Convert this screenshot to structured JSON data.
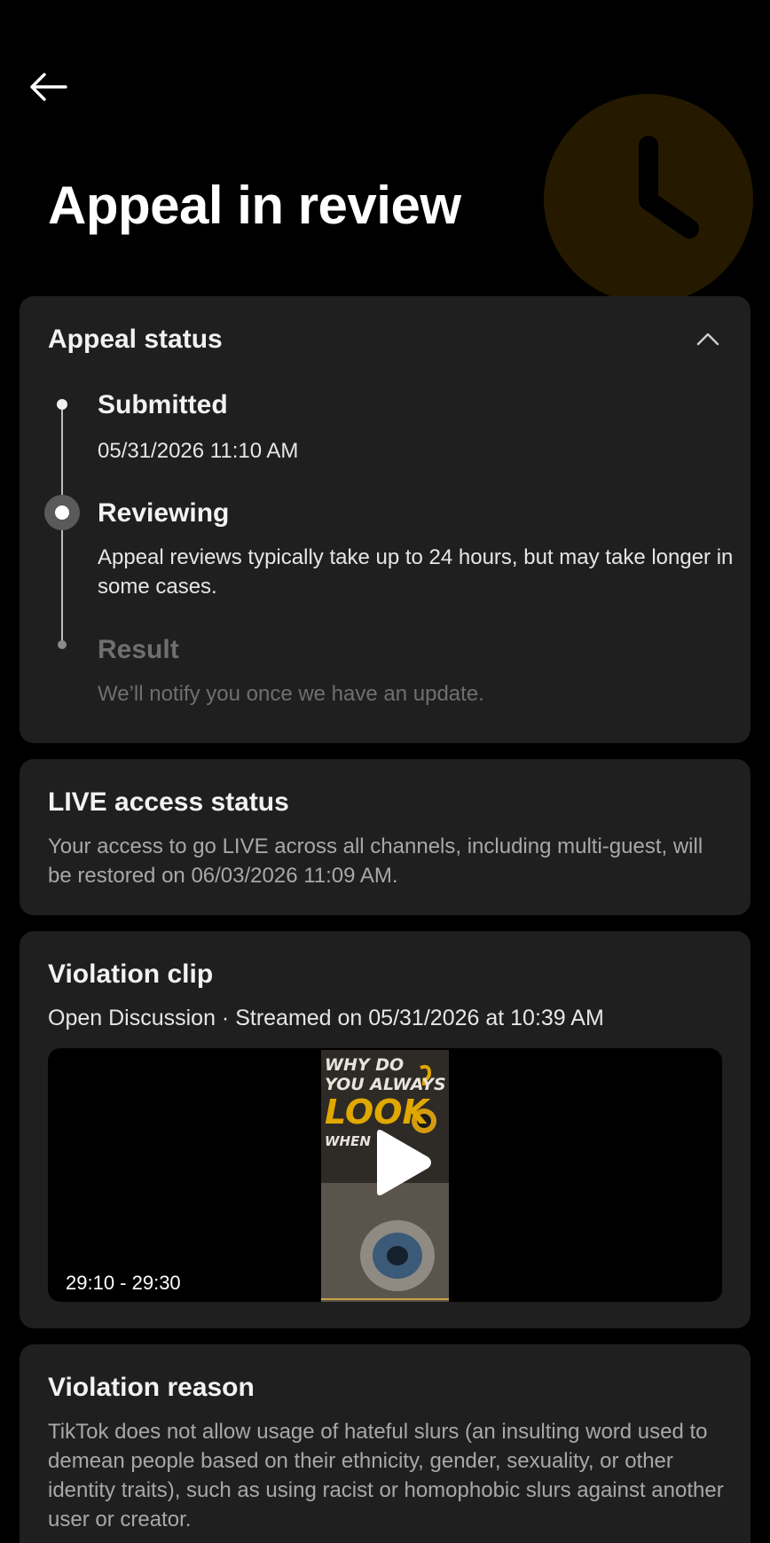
{
  "header": {
    "back_icon": "arrow-left-icon",
    "title": "Appeal in review",
    "hero_icon": "clock-icon",
    "hero_color": "#251900"
  },
  "appeal_status": {
    "title": "Appeal status",
    "collapse_icon": "chevron-up-icon",
    "steps": [
      {
        "title": "Submitted",
        "description": "05/31/2026 11:10 AM",
        "state": "done"
      },
      {
        "title": "Reviewing",
        "description": "Appeal reviews typically take up to 24 hours, but may take longer in some cases.",
        "state": "active"
      },
      {
        "title": "Result",
        "description": "We’ll notify you once we have an update.",
        "state": "pending"
      }
    ]
  },
  "live_access": {
    "title": "LIVE access status",
    "body": "Your access to go LIVE across all channels, including multi-guest, will be restored on 06/03/2026 11:09 AM."
  },
  "violation_clip": {
    "title": "Violation clip",
    "meta": "Open Discussion · Streamed on 05/31/2026 at 10:39 AM",
    "time_range": "29:10 - 29:30",
    "thumbnail_text": [
      "WHY DO",
      "YOU ALWAYS",
      "LOOK",
      "WHEN"
    ],
    "play_icon": "play-icon"
  },
  "violation_reason": {
    "title": "Violation reason",
    "body": "TikTok does not allow usage of hateful slurs (an insulting word used to demean people based on their ethnicity, gender, sexuality, or other identity traits), such as using racist or homophobic slurs against another user or creator."
  },
  "colors": {
    "background": "#000000",
    "card": "#1f1f1f",
    "accent_yellow": "#e0a800",
    "muted_text": "#6f6f6f"
  }
}
